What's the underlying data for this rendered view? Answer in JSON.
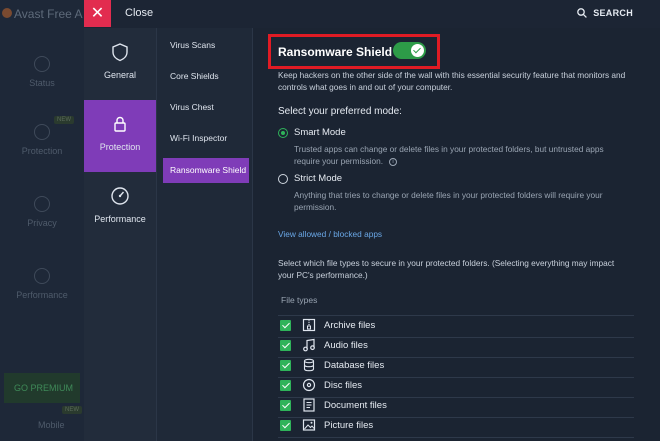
{
  "background_app": {
    "title": "Avast Free A",
    "nav": [
      {
        "label": "Status"
      },
      {
        "label": "Protection",
        "badge": "NEW"
      },
      {
        "label": "Privacy"
      },
      {
        "label": "Performance"
      }
    ],
    "premium": "GO PREMIUM",
    "mobile": "Mobile",
    "mobile_badge": "NEW"
  },
  "topbar": {
    "close_label": "Close",
    "search_label": "SEARCH"
  },
  "categories": [
    {
      "label": "General",
      "icon": "shield-icon"
    },
    {
      "label": "Protection",
      "icon": "lock-icon",
      "active": true
    },
    {
      "label": "Performance",
      "icon": "gauge-icon"
    }
  ],
  "submenu": [
    {
      "label": "Virus Scans"
    },
    {
      "label": "Core Shields"
    },
    {
      "label": "Virus Chest"
    },
    {
      "label": "Wi-Fi Inspector"
    },
    {
      "label": "Ransomware Shield",
      "active": true
    }
  ],
  "main": {
    "title": "Ransomware Shield",
    "toggle_on": true,
    "description_line1": "Keep hackers on the other side of the wall with this essential security feature that monitors and",
    "description_line2": "controls what goes in and out of your computer.",
    "mode_heading": "Select your preferred mode:",
    "smart_mode": {
      "label": "Smart Mode",
      "selected": true,
      "desc_line1": "Trusted apps can change or delete files in your protected folders, but untrusted apps",
      "desc_line2": "require your permission."
    },
    "strict_mode": {
      "label": "Strict Mode",
      "selected": false,
      "desc_line1": "Anything that tries to change or delete files in your protected folders will require your",
      "desc_line2": "permission."
    },
    "view_link": "View allowed / blocked apps",
    "file_types_desc_line1": "Select which file types to secure in your protected folders. (Selecting everything may impact",
    "file_types_desc_line2": "your PC's performance.)",
    "file_types_heading": "File types",
    "file_types": [
      {
        "label": "Archive files",
        "icon": "archive-icon",
        "checked": true
      },
      {
        "label": "Audio files",
        "icon": "music-note-icon",
        "checked": true
      },
      {
        "label": "Database files",
        "icon": "database-icon",
        "checked": true
      },
      {
        "label": "Disc files",
        "icon": "disc-icon",
        "checked": true
      },
      {
        "label": "Document files",
        "icon": "document-icon",
        "checked": true
      },
      {
        "label": "Picture files",
        "icon": "picture-icon",
        "checked": true
      }
    ]
  },
  "colors": {
    "accent_purple": "#7f3cb8",
    "close_red": "#e22c4f",
    "toggle_green": "#2d9b48",
    "highlight_red": "#e01b24",
    "link_blue": "#6aa7e6"
  }
}
